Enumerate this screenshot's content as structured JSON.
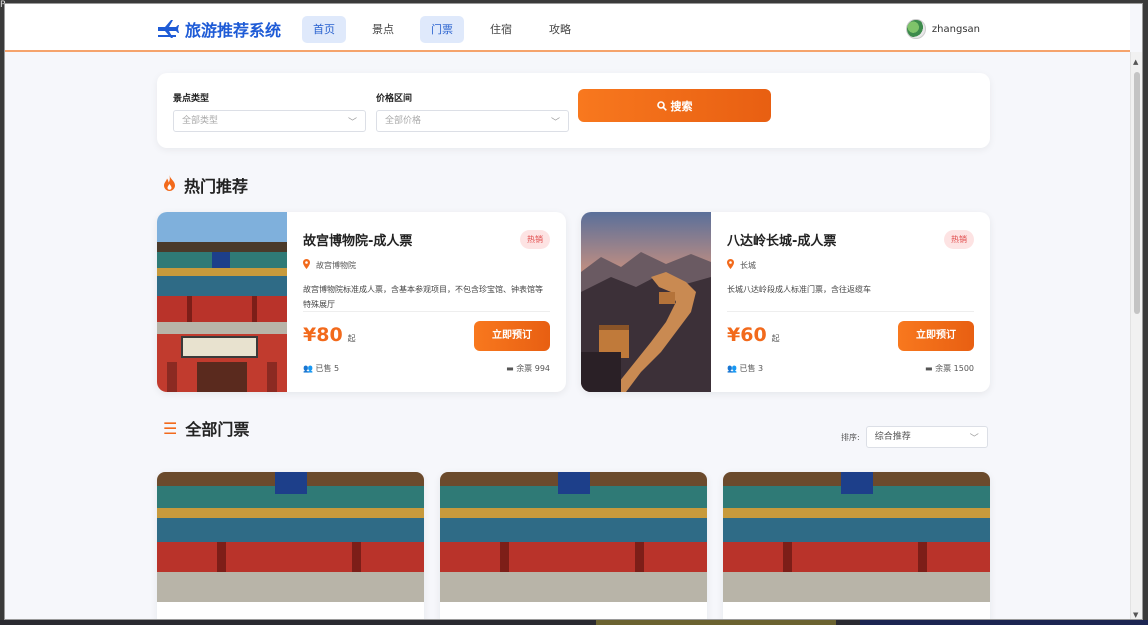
{
  "brand": {
    "name": "旅游推荐系统"
  },
  "nav": [
    "首页",
    "景点",
    "门票",
    "住宿",
    "攻略"
  ],
  "user": {
    "name": "zhangsan"
  },
  "search": {
    "type_label": "景点类型",
    "type_placeholder": "全部类型",
    "price_label": "价格区间",
    "price_placeholder": "全部价格",
    "button": "搜索"
  },
  "hot": {
    "title": "热门推荐",
    "cards": [
      {
        "name": "故宫博物院-成人票",
        "badge": "热销",
        "location": "故宫博物院",
        "desc": "故宫博物院标准成人票，含基本参观项目，不包含珍宝馆、钟表馆等特殊展厅",
        "price": "¥80",
        "price_suffix": "起",
        "book": "立即预订",
        "sold": "已售 5",
        "remain": "余票 994"
      },
      {
        "name": "八达岭长城-成人票",
        "badge": "热销",
        "location": "长城",
        "desc": "长城八达岭段成人标准门票，含往返缆车",
        "price": "¥60",
        "price_suffix": "起",
        "book": "立即预订",
        "sold": "已售 3",
        "remain": "余票 1500"
      }
    ]
  },
  "all": {
    "title": "全部门票",
    "sort_label": "排序:",
    "sort_value": "综合推荐"
  },
  "colors": {
    "accent": "#f26a1c",
    "brand": "#1e5bd6"
  }
}
